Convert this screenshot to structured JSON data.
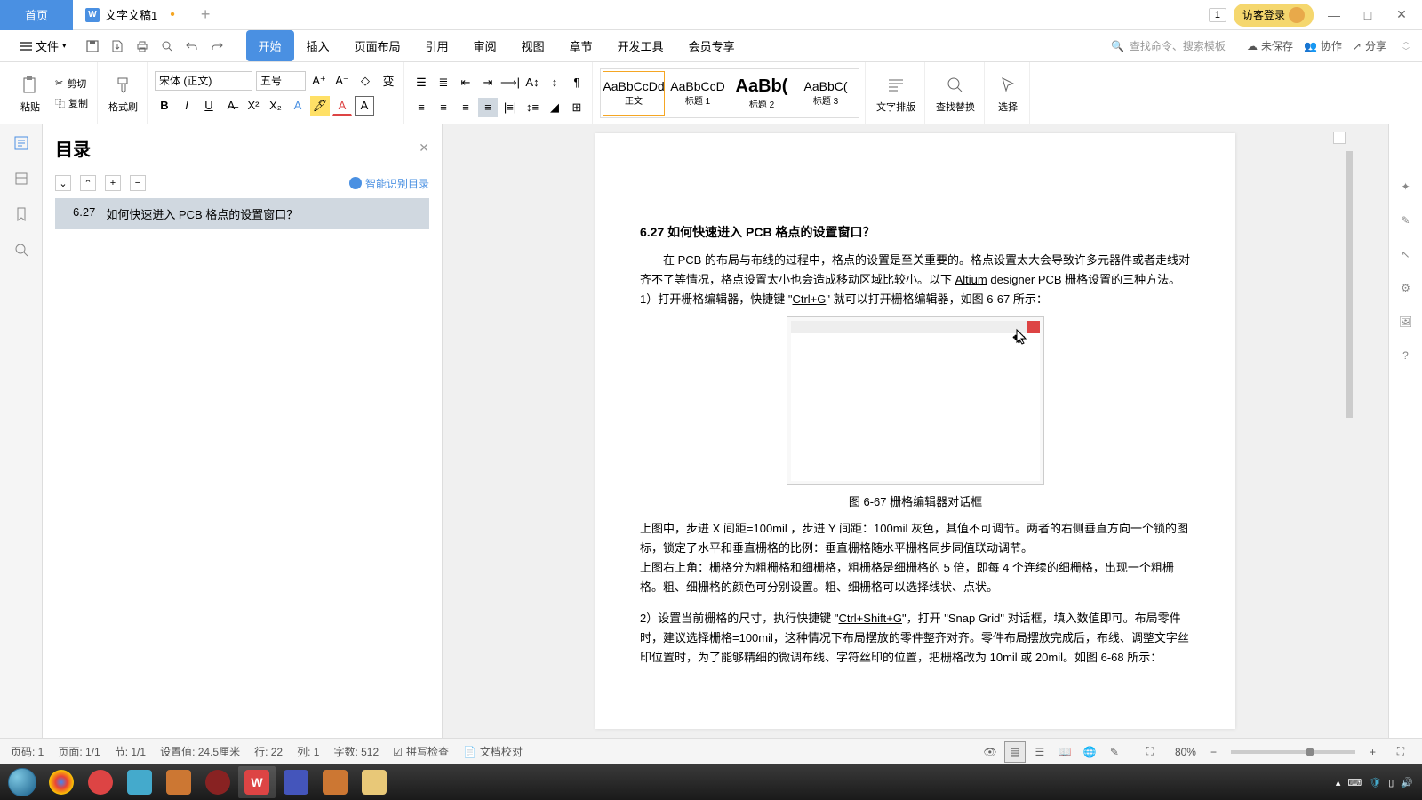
{
  "titlebar": {
    "home": "首页",
    "doc_title": "文字文稿1",
    "tab_count": "1",
    "login": "访客登录"
  },
  "menubar": {
    "file": "文件",
    "tabs": [
      "开始",
      "插入",
      "页面布局",
      "引用",
      "审阅",
      "视图",
      "章节",
      "开发工具",
      "会员专享"
    ],
    "active_tab": 0,
    "search_placeholder": "查找命令、搜索模板",
    "unsaved": "未保存",
    "collab": "协作",
    "share": "分享"
  },
  "ribbon": {
    "paste": "粘贴",
    "cut": "剪切",
    "copy": "复制",
    "format_painter": "格式刷",
    "font_name": "宋体 (正文)",
    "font_size": "五号",
    "styles": [
      {
        "preview": "AaBbCcDd",
        "name": "正文"
      },
      {
        "preview": "AaBbCcD",
        "name": "标题 1"
      },
      {
        "preview": "AaBb(",
        "name": "标题 2"
      },
      {
        "preview": "AaBbC(",
        "name": "标题 3"
      }
    ],
    "text_layout": "文字排版",
    "find_replace": "查找替换",
    "select": "选择"
  },
  "toc": {
    "title": "目录",
    "smart_detect": "智能识别目录",
    "items": [
      {
        "num": "6.27",
        "text": "如何快速进入 PCB 格点的设置窗口？"
      }
    ]
  },
  "document": {
    "heading": "6.27   如何快速进入 PCB 格点的设置窗口？",
    "para1_a": "在 PCB 的布局与布线的过程中，格点的设置是至关重要的。格点设置太大会导致许多元器件或者走线对齐不了等情况，格点设置太小也会造成移动区域比较小。以下 ",
    "para1_link": "Altium",
    "para1_b": " designer PCB 栅格设置的三种方法。",
    "para2_a": "1）打开栅格编辑器，快捷键 \"",
    "para2_key": "Ctrl+G",
    "para2_b": "\" 就可以打开栅格编辑器，如图 6-67 所示：",
    "caption1": "图 6-67 栅格编辑器对话框",
    "para3": "上图中，步进 X 间距=100mil ，步进 Y 间距：100mil 灰色，其值不可调节。两者的右侧垂直方向一个锁的图标，锁定了水平和垂直栅格的比例：垂直栅格随水平栅格同步同值联动调节。",
    "para4": "上图右上角：栅格分为粗栅格和细栅格，粗栅格是细栅格的 5 倍，即每 4 个连续的细栅格，出现一个粗栅格。粗、细栅格的颜色可分别设置。粗、细栅格可以选择线状、点状。",
    "para5_a": "2）设置当前栅格的尺寸，执行快捷键 \"",
    "para5_key": "Ctrl+Shift+G",
    "para5_b": "\"，打开 \"Snap Grid\" 对话框，填入数值即可。布局零件时，建议选择栅格=100mil，这种情况下布局摆放的零件整齐对齐。零件布局摆放完成后，布线、调整文字丝印位置时，为了能够精细的微调布线、字符丝印的位置，把栅格改为 10mil 或 20mil。如图 6-68 所示："
  },
  "statusbar": {
    "page_num": "页码: 1",
    "page": "页面: 1/1",
    "section": "节: 1/1",
    "setting": "设置值: 24.5厘米",
    "line": "行: 22",
    "col": "列: 1",
    "chars": "字数: 512",
    "spell": "拼写检查",
    "doc_check": "文档校对",
    "zoom": "80%"
  }
}
